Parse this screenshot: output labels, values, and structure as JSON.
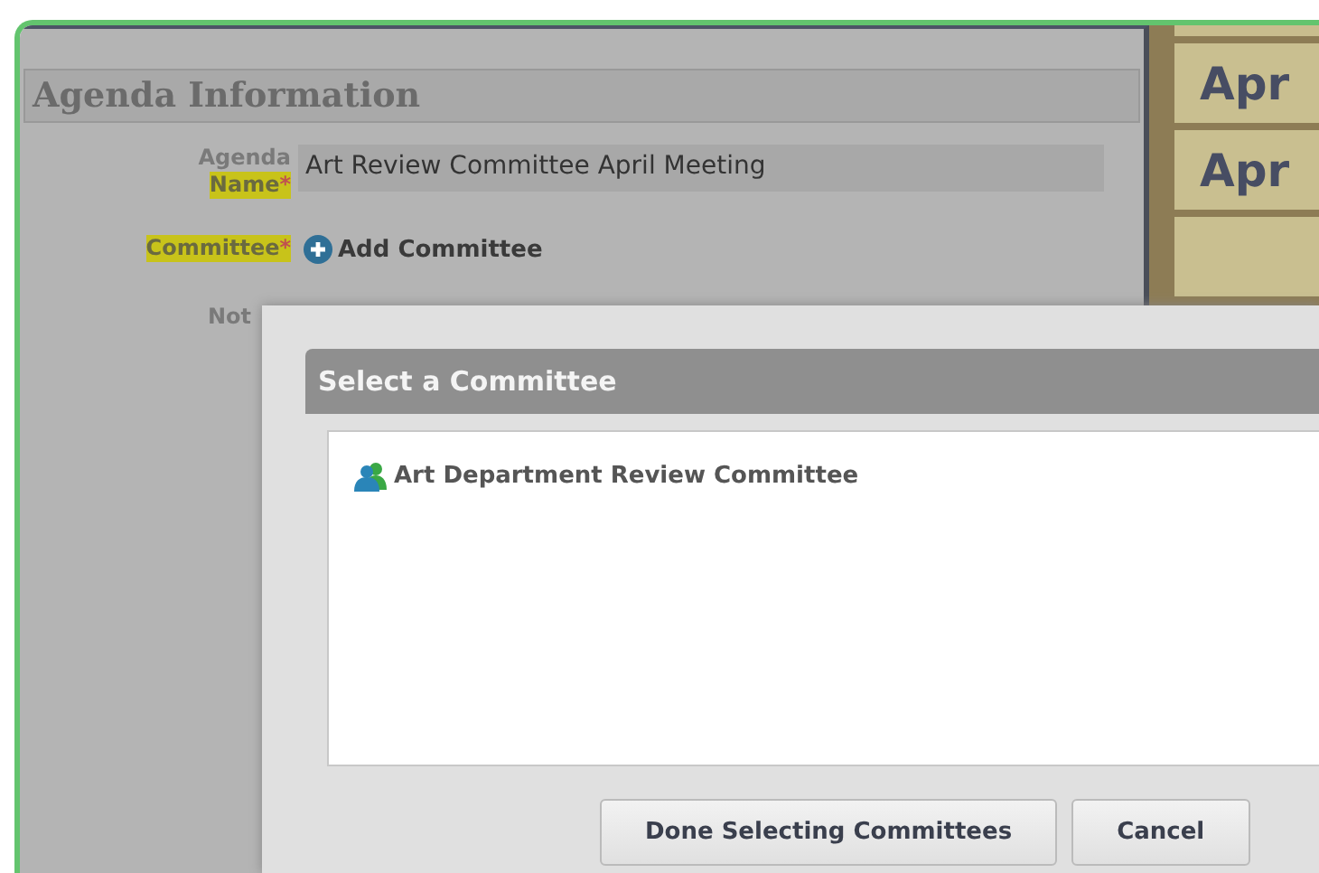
{
  "section": {
    "title": "Agenda Information"
  },
  "fields": [
    {
      "kind": "text",
      "label_lines": [
        {
          "text": "Agenda",
          "highlighted": false
        },
        {
          "text": "Name",
          "highlighted": true,
          "asterisk": "*"
        }
      ],
      "value": "Art Review Committee April Meeting"
    },
    {
      "kind": "add",
      "label_lines": [
        {
          "text": "Committee",
          "highlighted": true,
          "asterisk": "*"
        }
      ],
      "action": "Add Committee"
    },
    {
      "kind": "cut",
      "label_lines": [
        {
          "text": "Not",
          "highlighted": false
        }
      ]
    }
  ],
  "sidebar": {
    "cards": [
      {
        "label": "Apr"
      },
      {
        "label": "Apr"
      }
    ]
  },
  "dialog": {
    "title": "Select a Committee",
    "items": [
      {
        "label": "Art Department Review Committee"
      }
    ],
    "buttons": [
      "Done Selecting Committees",
      "Cancel"
    ]
  }
}
